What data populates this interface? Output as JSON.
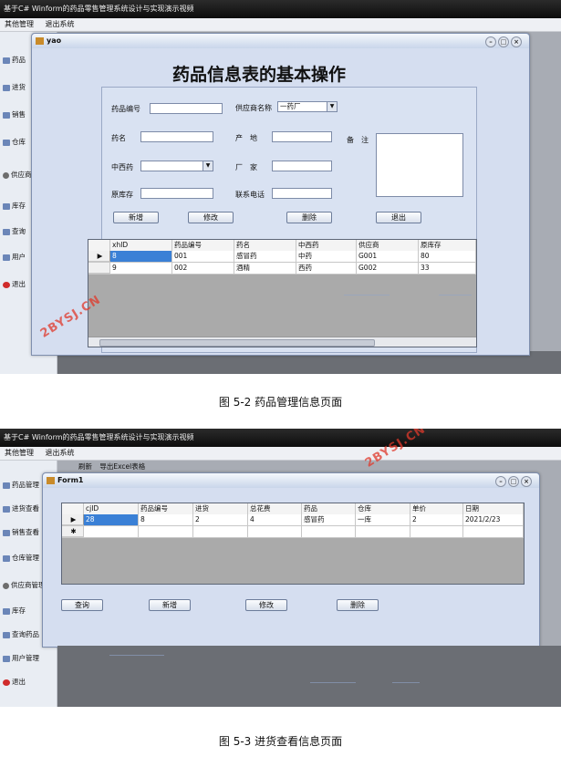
{
  "shot1": {
    "app_title": "基于C# Winform的药品零售管理系统设计与实现演示视频",
    "menu": [
      "其他管理",
      "退出系统"
    ],
    "sidebar": [
      {
        "label": "药品",
        "icon": "app-icon"
      },
      {
        "label": "进货",
        "icon": "app-icon"
      },
      {
        "label": "销售",
        "icon": "app-icon"
      },
      {
        "label": "仓库",
        "icon": "app-icon"
      },
      {
        "label": "供应商",
        "icon": "people-icon"
      },
      {
        "label": "库存",
        "icon": "app-icon"
      },
      {
        "label": "查询",
        "icon": "app-icon"
      },
      {
        "label": "用户",
        "icon": "app-icon"
      },
      {
        "label": "退出",
        "icon": "exit-icon"
      }
    ],
    "window_title": "yao",
    "heading": "药品信息表的基本操作",
    "fields": {
      "drug_id_label": "药品编号",
      "drug_id_value": "",
      "supplier_label": "供应商名称",
      "supplier_value": "一药厂",
      "name_label": "药名",
      "name_value": "",
      "origin_label": "产　地",
      "origin_value": "",
      "remark_label": "备　注",
      "remark_value": "",
      "type_label": "中西药",
      "type_value": "",
      "maker_label": "厂　家",
      "maker_value": "",
      "stock_label": "原库存",
      "stock_value": "",
      "phone_label": "联系电话",
      "phone_value": ""
    },
    "buttons": {
      "add": "新增",
      "edit": "修改",
      "delete": "删除",
      "exit": "退出"
    },
    "grid": {
      "columns": [
        "xhID",
        "药品编号",
        "药名",
        "中西药",
        "供应商",
        "原库存"
      ],
      "rows": [
        [
          "8",
          "001",
          "感冒药",
          "中药",
          "G001",
          "80"
        ],
        [
          "9",
          "002",
          "酒精",
          "西药",
          "G002",
          "33"
        ]
      ],
      "current_row_marker": "▶"
    },
    "caption": "图 5-2 药品管理信息页面"
  },
  "shot2": {
    "app_title": "基于C# Winform的药品零售管理系统设计与实现演示视频",
    "menu": [
      "其他管理",
      "退出系统"
    ],
    "toolbar": [
      "刷新",
      "导出Excel表格"
    ],
    "sidebar": [
      {
        "label": "药品管理",
        "icon": "app-icon"
      },
      {
        "label": "进货查看",
        "icon": "app-icon"
      },
      {
        "label": "销售查看",
        "icon": "app-icon"
      },
      {
        "label": "仓库管理",
        "icon": "app-icon"
      },
      {
        "label": "供应商管理",
        "icon": "people-icon"
      },
      {
        "label": "库存",
        "icon": "app-icon"
      },
      {
        "label": "查询药品",
        "icon": "app-icon"
      },
      {
        "label": "用户管理",
        "icon": "app-icon"
      },
      {
        "label": "退出",
        "icon": "exit-icon"
      }
    ],
    "window_title": "Form1",
    "grid": {
      "columns": [
        "cjID",
        "药品编号",
        "进货",
        "总花费",
        "药品",
        "仓库",
        "单价",
        "日期"
      ],
      "rows": [
        [
          "28",
          "8",
          "2",
          "4",
          "感冒药",
          "一库",
          "2",
          "2021/2/23"
        ]
      ],
      "current_row_marker": "▶",
      "new_row_marker": "✱"
    },
    "buttons": {
      "query": "查询",
      "add": "新增",
      "edit": "修改",
      "delete": "删除"
    },
    "caption": "图 5-3 进货查看信息页面"
  },
  "watermark": "2BYSJ.CN",
  "colors": {
    "selection": "#3a80d6",
    "window_bg": "#d5def0",
    "title_bar": "#111111",
    "watermark": "#e0392b"
  }
}
